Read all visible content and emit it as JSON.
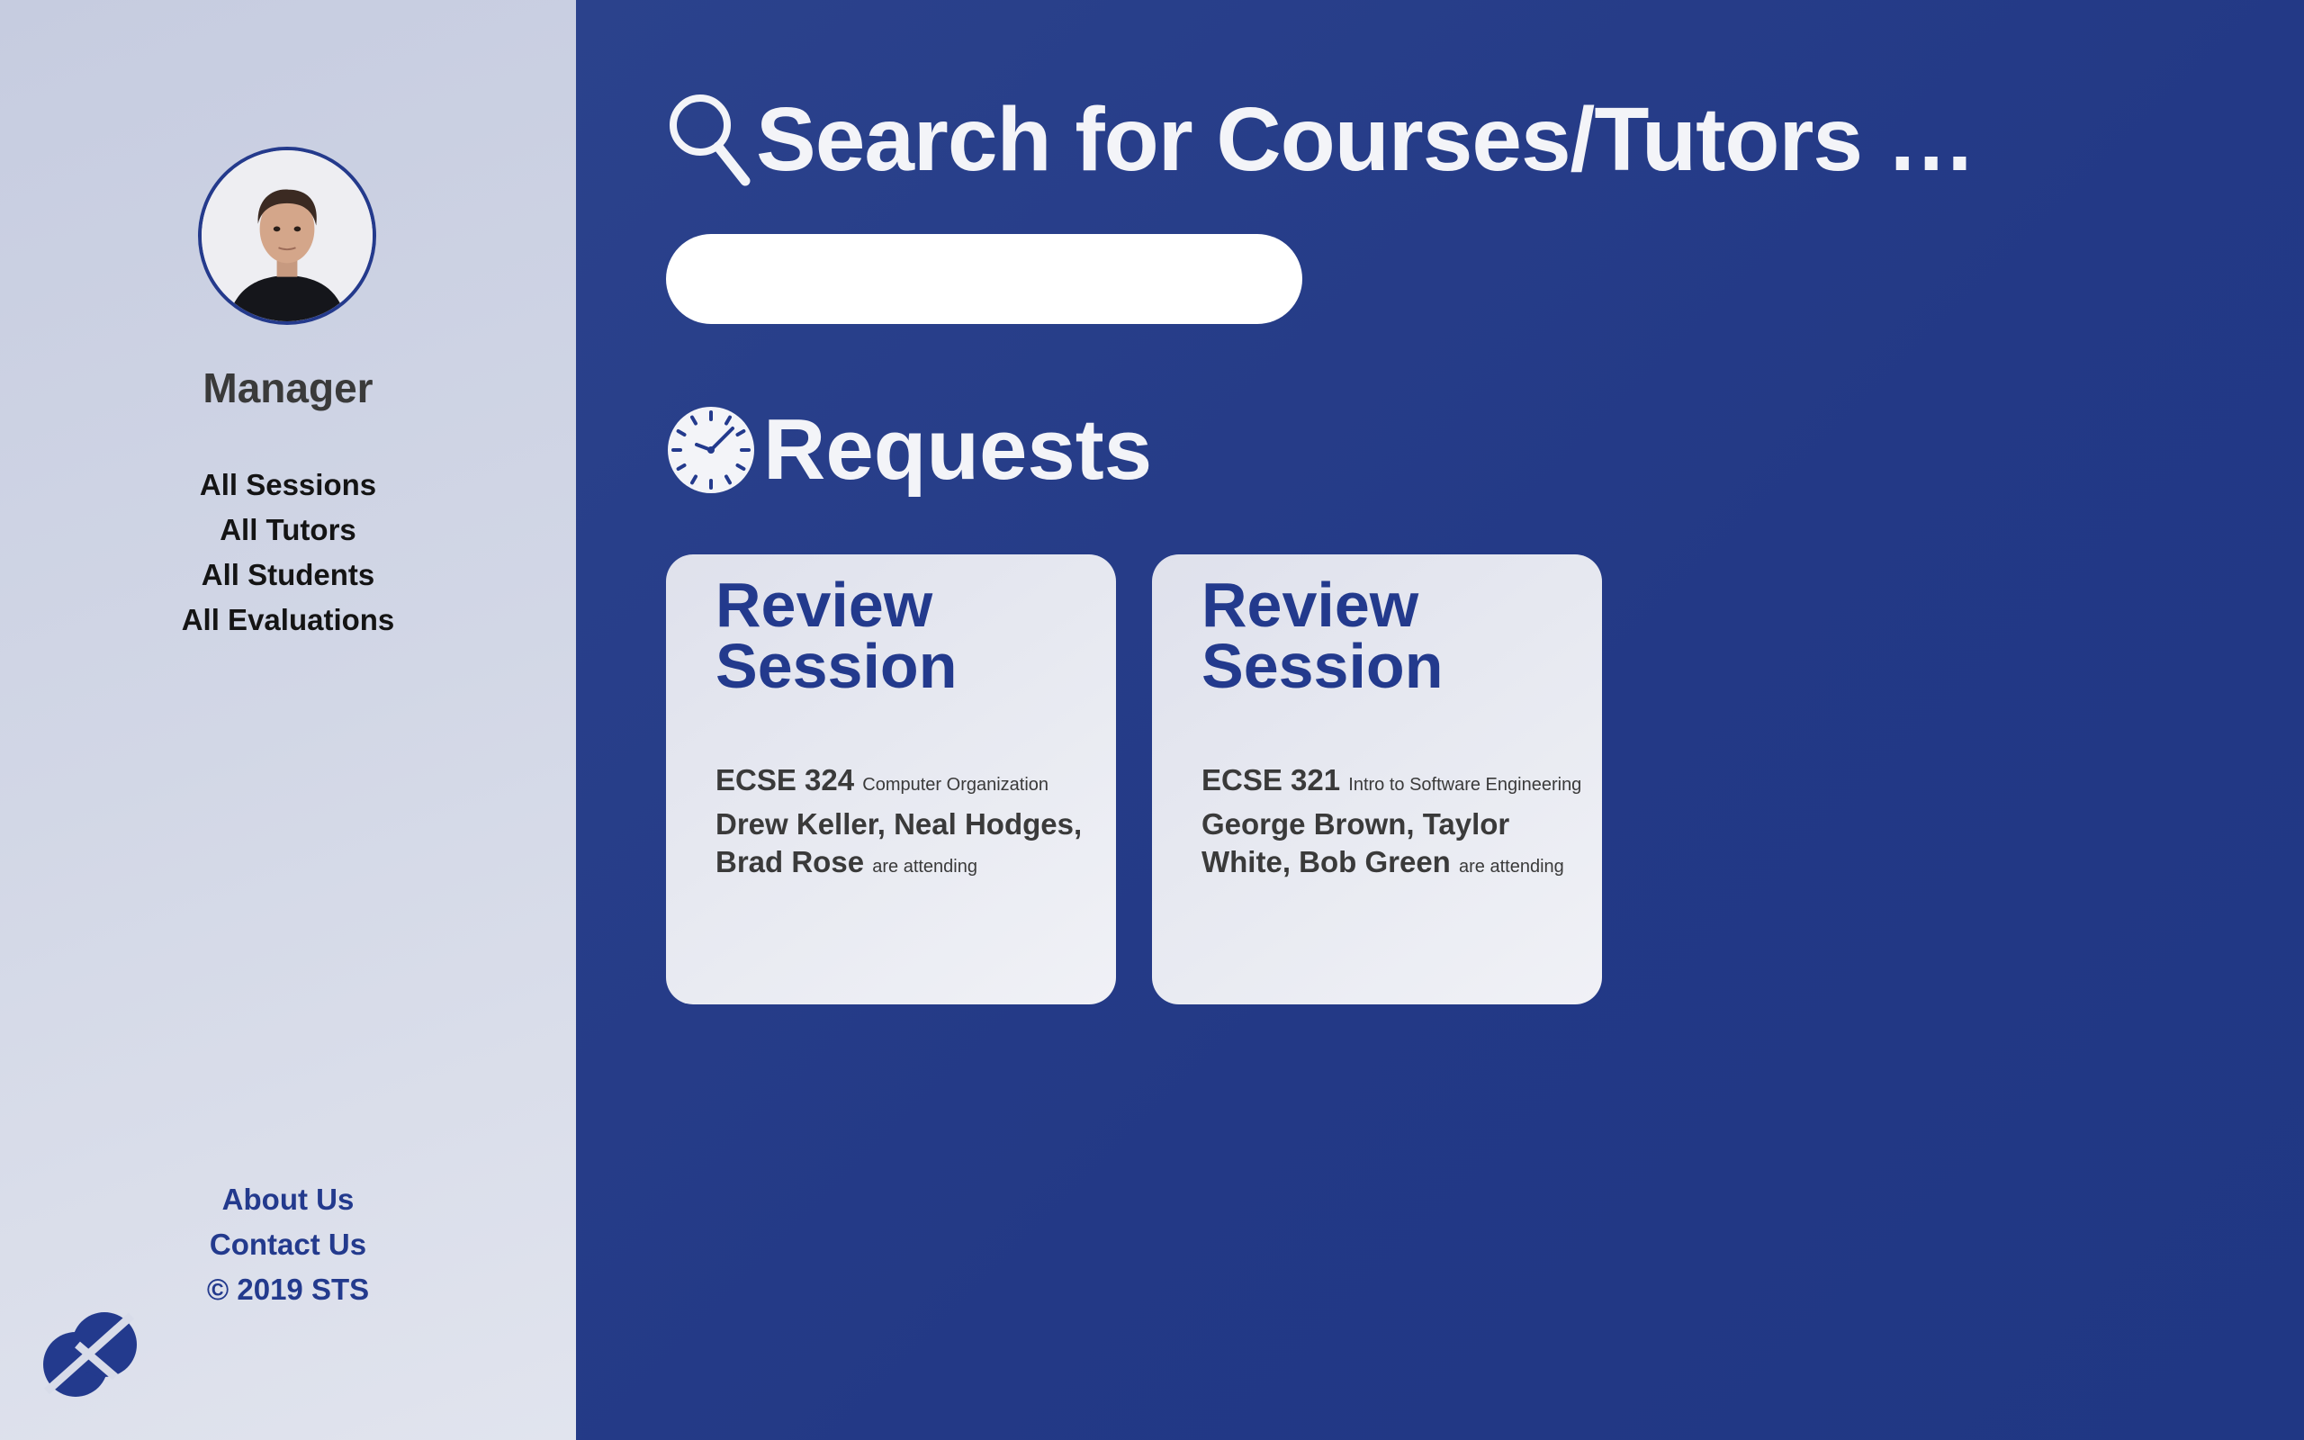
{
  "sidebar": {
    "role": "Manager",
    "nav": [
      "All Sessions",
      "All Tutors",
      "All Students",
      "All Evaluations"
    ],
    "footer": {
      "about": "About Us",
      "contact": "Contact Us",
      "copyright": "© 2019 STS"
    }
  },
  "main": {
    "search_title": "Search for Courses/Tutors …",
    "search_value": "",
    "requests_title": "Requests",
    "cards": [
      {
        "title": "Review Session",
        "course_code": "ECSE 324",
        "course_name": "Computer Organization",
        "attendees": "Drew Keller, Neal Hodges, Brad Rose",
        "suffix": "are attending"
      },
      {
        "title": "Review Session",
        "course_code": "ECSE 321",
        "course_name": "Intro to Software Engineering",
        "attendees": "George Brown, Taylor White, Bob Green",
        "suffix": "are attending"
      }
    ]
  },
  "icons": {
    "search": "search-icon",
    "clock": "clock-icon",
    "logo": "sts-logo"
  },
  "colors": {
    "primary": "#233a8d",
    "sidebar_bg": "#d2d7e6",
    "card_bg": "#e9ebf2",
    "heading_text": "#f3f4f8"
  }
}
